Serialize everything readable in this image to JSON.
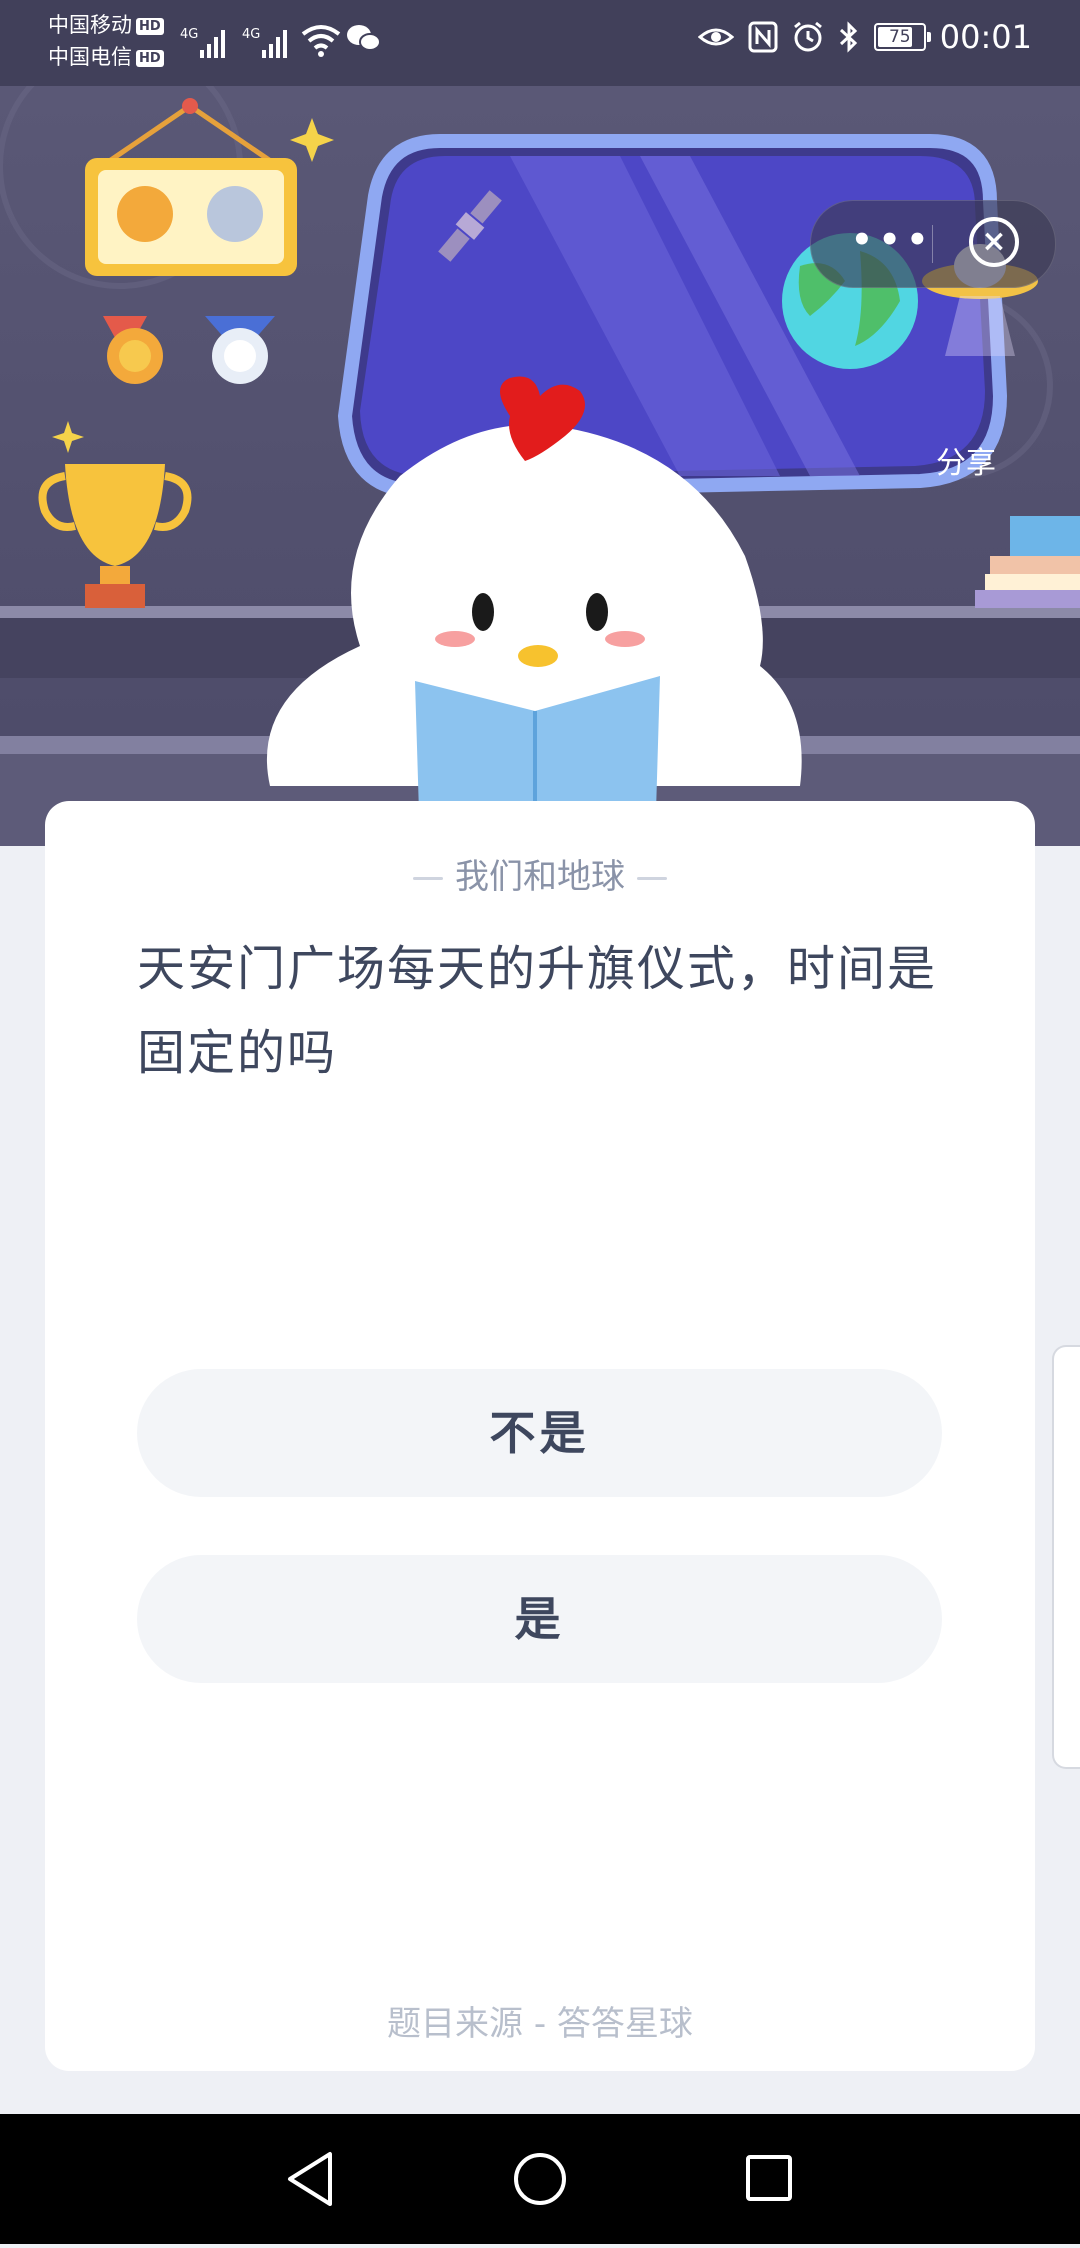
{
  "status_bar": {
    "carrier_1": "中国移动",
    "carrier_2": "中国电信",
    "hd_badge": "HD",
    "network_1": "4G",
    "network_2": "4G",
    "battery_level": "75",
    "time": "00:01"
  },
  "mini_program": {
    "share_label": "分享"
  },
  "quiz": {
    "category": "我们和地球",
    "question": "天安门广场每天的升旗仪式，时间是固定的吗",
    "options": [
      {
        "label": "不是"
      },
      {
        "label": "是"
      }
    ],
    "source": "题目来源 - 答答星球"
  },
  "colors": {
    "hero_background": "#55536f",
    "text_primary": "#3e475e",
    "text_secondary": "#8a93a8",
    "option_background": "#f3f5f8"
  }
}
